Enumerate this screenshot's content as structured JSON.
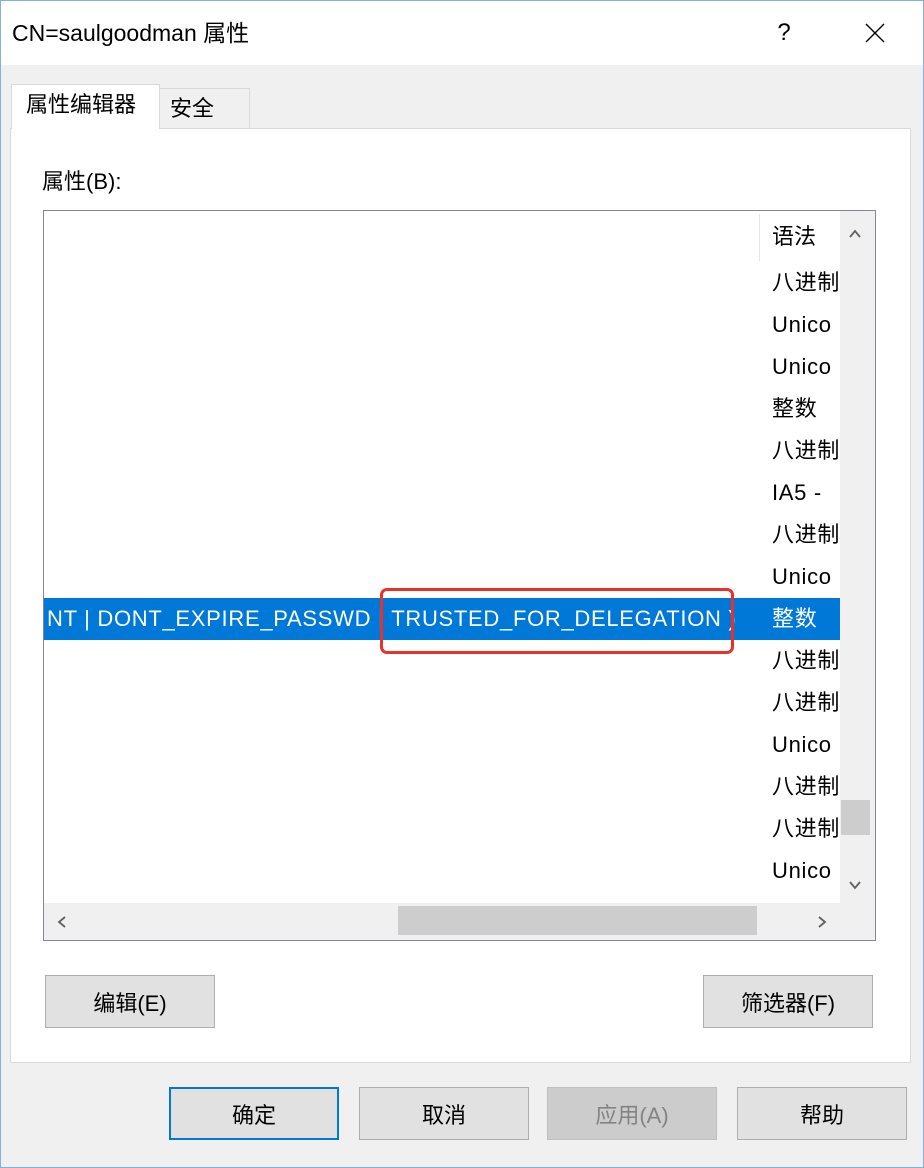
{
  "window": {
    "title": "CN=saulgoodman 属性",
    "help_label": "?"
  },
  "tabs": [
    {
      "label": "属性编辑器",
      "selected": true
    },
    {
      "label": "安全",
      "selected": false
    }
  ],
  "attributes": {
    "label": "属性(B):",
    "column_header": "语法",
    "rows": [
      {
        "syntax": "八进制"
      },
      {
        "syntax": "Unico"
      },
      {
        "syntax": "Unico"
      },
      {
        "syntax": "整数"
      },
      {
        "syntax": "八进制"
      },
      {
        "syntax": "IA5 - "
      },
      {
        "syntax": "八进制"
      },
      {
        "syntax": "Unico"
      },
      {
        "syntax": "整数",
        "selected": true,
        "value_prefix": "NT | DONT_EXPIRE_PASSWD | ",
        "value_highlighted": "TRUSTED_FOR_DELEGATION",
        "value_suffix": " )"
      },
      {
        "syntax": "八进制"
      },
      {
        "syntax": "八进制"
      },
      {
        "syntax": "Unico"
      },
      {
        "syntax": "八进制"
      },
      {
        "syntax": "八进制"
      },
      {
        "syntax": "Unico"
      }
    ]
  },
  "buttons": {
    "edit": "编辑(E)",
    "filter": "筛选器(F)",
    "ok": "确定",
    "cancel": "取消",
    "apply": "应用(A)",
    "apply_enabled": false,
    "help": "帮助"
  },
  "icons": {
    "close": "close-icon",
    "scroll_up": "chevron-up-icon",
    "scroll_down": "chevron-down-icon",
    "scroll_left": "chevron-left-icon",
    "scroll_right": "chevron-right-icon"
  },
  "colors": {
    "selection": "#0078d7",
    "annotation": "#e8312a",
    "default_button_border": "#0078d7"
  }
}
